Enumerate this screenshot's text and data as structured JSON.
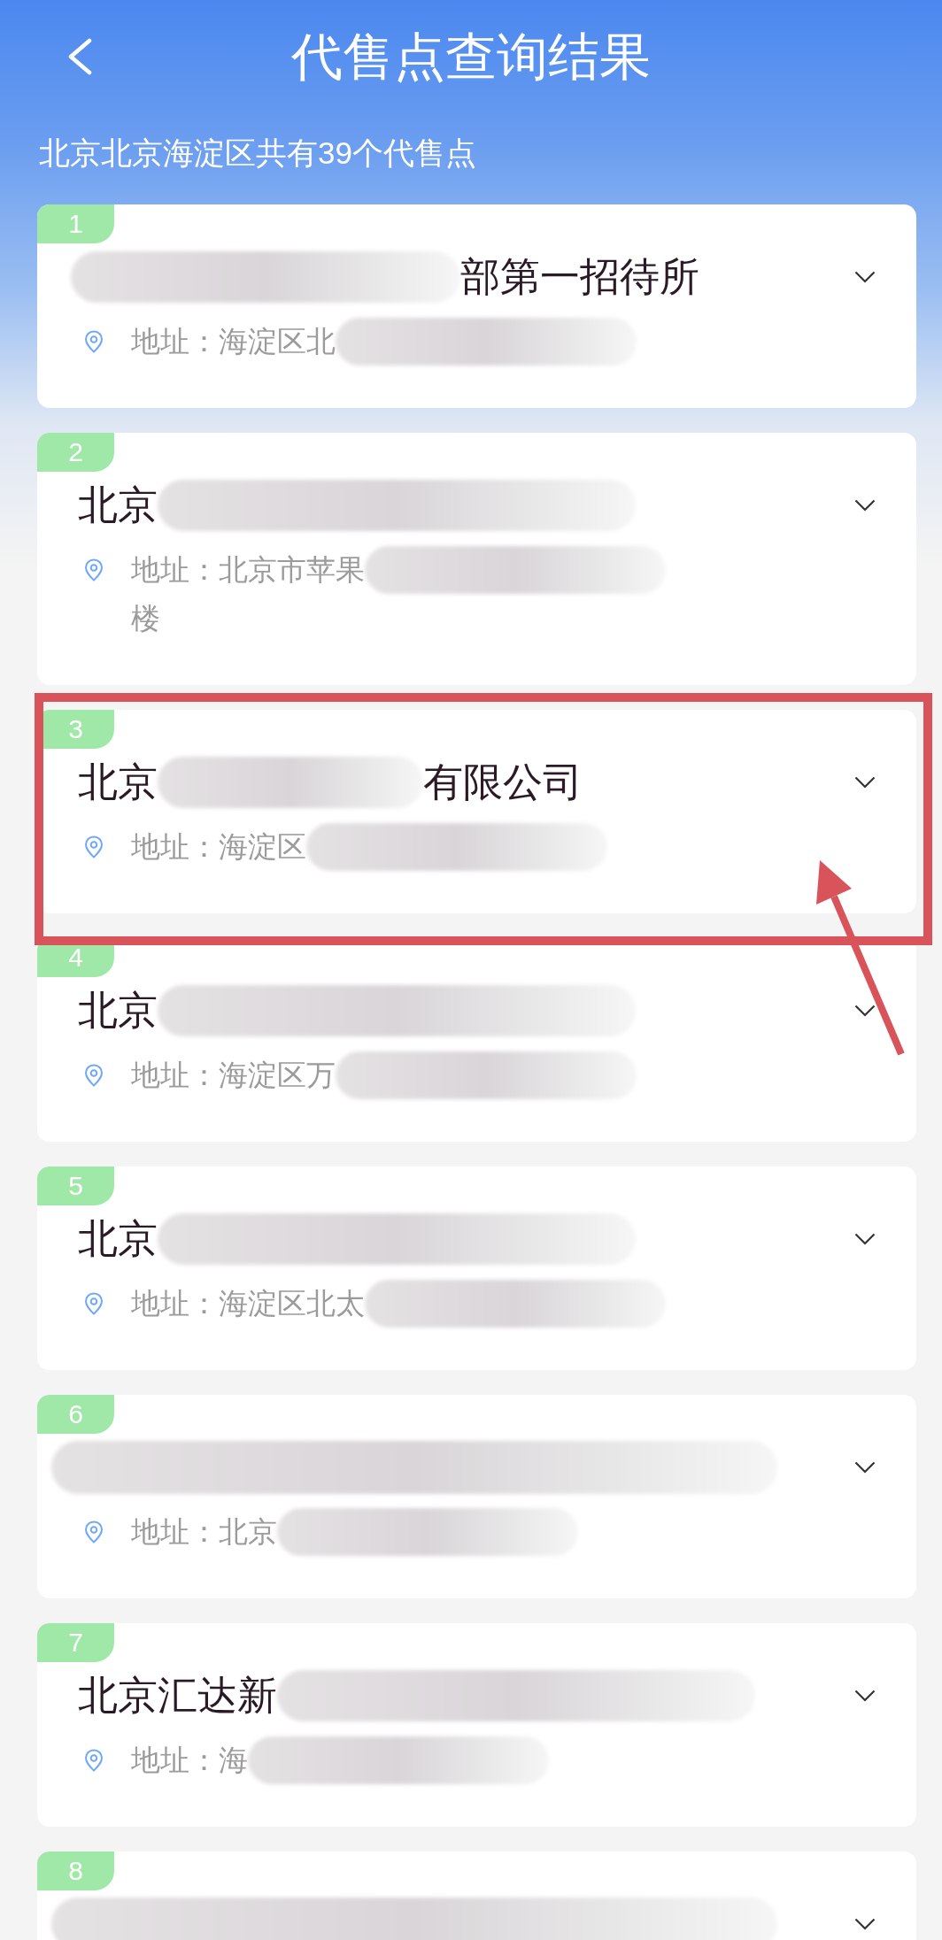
{
  "header": {
    "title": "代售点查询结果"
  },
  "summary": "北京北京海淀区共有39个代售点",
  "cards": [
    {
      "number": "1",
      "highlighted": false,
      "title": [
        {
          "kind": "redacted"
        },
        {
          "kind": "text",
          "text": "部第一招待所"
        }
      ],
      "address_lines": [
        [
          {
            "kind": "text",
            "text": "地址：海淀区北"
          },
          {
            "kind": "redacted"
          }
        ]
      ]
    },
    {
      "number": "2",
      "highlighted": false,
      "title": [
        {
          "kind": "text",
          "text": "北京"
        },
        {
          "kind": "redacted"
        }
      ],
      "address_lines": [
        [
          {
            "kind": "text",
            "text": "地址：北京市苹果"
          },
          {
            "kind": "redacted"
          }
        ],
        [
          {
            "kind": "text",
            "text": "楼"
          }
        ]
      ]
    },
    {
      "number": "3",
      "highlighted": true,
      "title": [
        {
          "kind": "text",
          "text": "北京"
        },
        {
          "kind": "redacted"
        },
        {
          "kind": "text",
          "text": "有限公司"
        }
      ],
      "address_lines": [
        [
          {
            "kind": "text",
            "text": "地址：海淀区"
          },
          {
            "kind": "redacted"
          }
        ]
      ]
    },
    {
      "number": "4",
      "highlighted": false,
      "title": [
        {
          "kind": "text",
          "text": "北京"
        },
        {
          "kind": "redacted"
        }
      ],
      "address_lines": [
        [
          {
            "kind": "text",
            "text": "地址：海淀区万"
          },
          {
            "kind": "redacted"
          }
        ]
      ]
    },
    {
      "number": "5",
      "highlighted": false,
      "title": [
        {
          "kind": "text",
          "text": "北京"
        },
        {
          "kind": "redacted"
        }
      ],
      "address_lines": [
        [
          {
            "kind": "text",
            "text": "地址：海淀区北太"
          },
          {
            "kind": "redacted"
          }
        ]
      ]
    },
    {
      "number": "6",
      "highlighted": false,
      "title": [
        {
          "kind": "redacted"
        }
      ],
      "address_lines": [
        [
          {
            "kind": "text",
            "text": "地址：北京"
          },
          {
            "kind": "redacted"
          }
        ]
      ]
    },
    {
      "number": "7",
      "highlighted": false,
      "title": [
        {
          "kind": "text",
          "text": "北京汇达新"
        },
        {
          "kind": "redacted"
        }
      ],
      "address_lines": [
        [
          {
            "kind": "text",
            "text": "地址：海"
          },
          {
            "kind": "redacted"
          }
        ]
      ]
    },
    {
      "number": "8",
      "highlighted": false,
      "title": [
        {
          "kind": "redacted"
        }
      ]
    }
  ]
}
